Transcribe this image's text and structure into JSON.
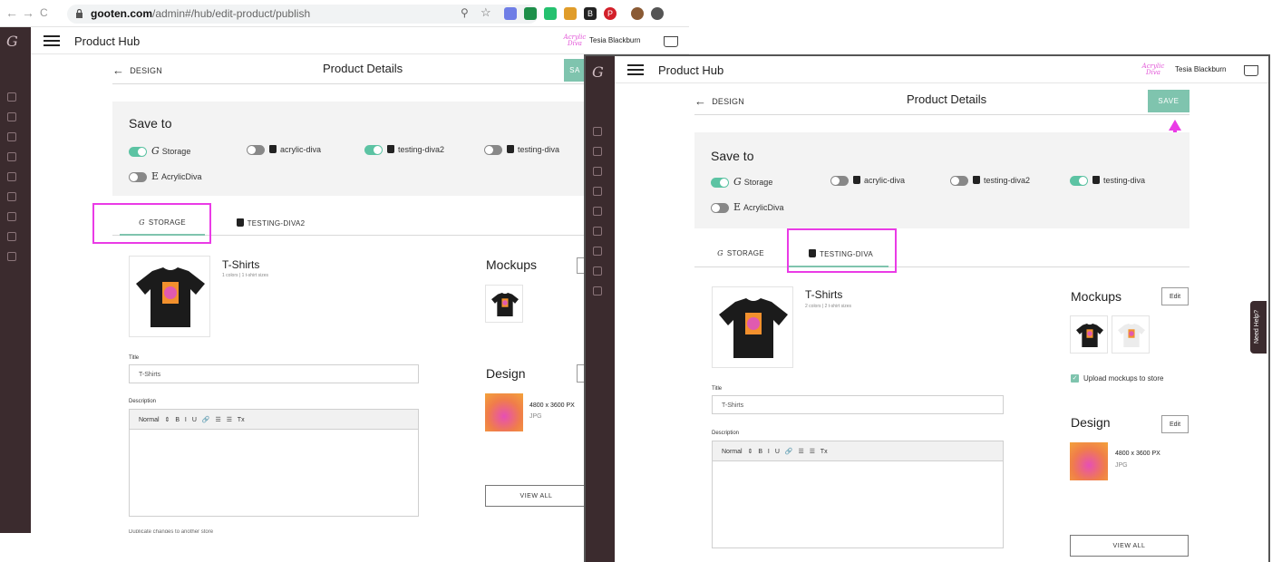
{
  "browser": {
    "url_host": "gooten.com",
    "url_path": "/admin#/hub/edit-product/publish",
    "nav_back": "←",
    "nav_forward": "→",
    "nav_reload": "C"
  },
  "app": {
    "title": "Product Hub",
    "logo": "G",
    "user_name": "Tesia Blackburn",
    "store_logo_text": "Acrylic\nDiva"
  },
  "page": {
    "back_label": "DESIGN",
    "title": "Product Details",
    "save_label": "SAVE",
    "save_label_cropped": "SA"
  },
  "save_to": {
    "heading": "Save to",
    "left": [
      {
        "label": "Storage",
        "on": true,
        "kind": "gooten"
      },
      {
        "label": "acrylic-diva",
        "on": false,
        "kind": "shopify"
      },
      {
        "label": "testing-diva2",
        "on": true,
        "kind": "shopify"
      },
      {
        "label": "testing-diva",
        "on": false,
        "kind": "shopify"
      },
      {
        "label": "AcrylicDiva",
        "on": false,
        "kind": "etsy"
      }
    ],
    "right": [
      {
        "label": "Storage",
        "on": true,
        "kind": "gooten"
      },
      {
        "label": "acrylic-diva",
        "on": false,
        "kind": "shopify"
      },
      {
        "label": "testing-diva2",
        "on": false,
        "kind": "shopify"
      },
      {
        "label": "testing-diva",
        "on": true,
        "kind": "shopify"
      },
      {
        "label": "AcrylicDiva",
        "on": false,
        "kind": "etsy"
      }
    ]
  },
  "tabs_left": [
    {
      "label": "STORAGE",
      "active": true
    },
    {
      "label": "TESTING-DIVA2",
      "active": false
    }
  ],
  "tabs_right": [
    {
      "label": "STORAGE",
      "active": false
    },
    {
      "label": "TESTING-DIVA",
      "active": true
    }
  ],
  "product_left": {
    "name": "T-Shirts",
    "meta": "1 colors | 1 t-shirt sizes"
  },
  "product_right": {
    "name": "T-Shirts",
    "meta": "2 colors | 2 t-shirt sizes"
  },
  "form": {
    "title_label": "Title",
    "title_value": "T-Shirts",
    "description_label": "Description",
    "toolbar": "Normal  ⇕  B  I  U  🔗  ☰  ☰  Tx",
    "cut_label": "Duplicate changes to another store"
  },
  "mockups": {
    "heading": "Mockups",
    "edit": "Edit",
    "upload_label": "Upload mockups to store"
  },
  "design": {
    "heading": "Design",
    "edit": "Edit",
    "size": "4800 x 3600 PX",
    "format": "JPG",
    "view_all": "VIEW ALL"
  },
  "help": {
    "label": "Need Help?"
  },
  "colors": {
    "accent": "#7fc4ae",
    "rail": "#3b2b2e",
    "highlight": "#ea3be6",
    "toggle_on": "#5cc3a3"
  }
}
